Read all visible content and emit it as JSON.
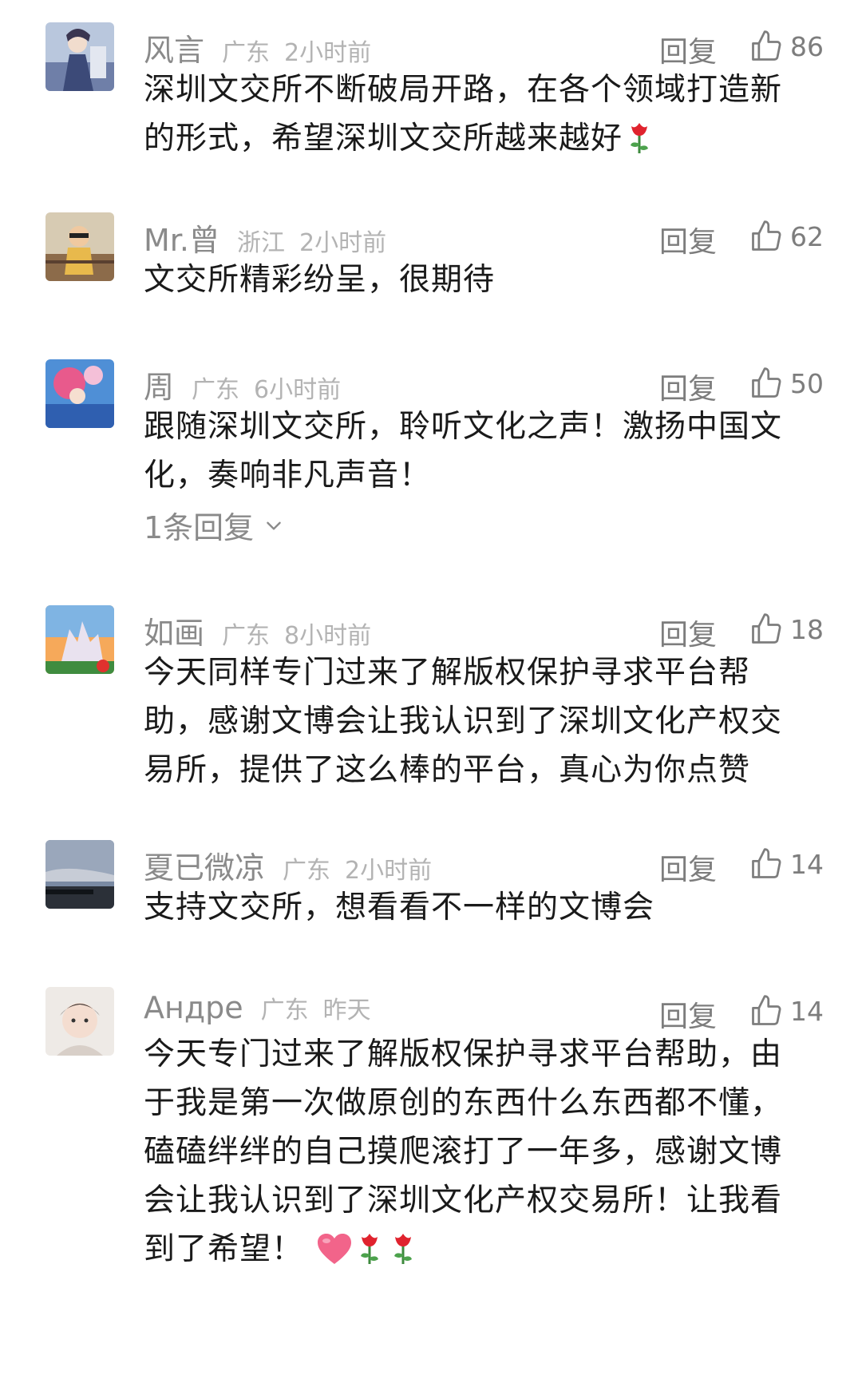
{
  "labels": {
    "reply": "回复"
  },
  "comments": [
    {
      "username": "风言",
      "location": "广东",
      "time": "2小时前",
      "likes": "86",
      "lines": [
        "深圳文交所不断破局开路，在各个领域打造新",
        "的形式，希望深圳文交所越来越好"
      ],
      "emoji": [
        "rose"
      ]
    },
    {
      "username": "Mr.曾",
      "location": "浙江",
      "time": "2小时前",
      "likes": "62",
      "lines": [
        "文交所精彩纷呈，很期待"
      ],
      "emoji": []
    },
    {
      "username": "周",
      "location": "广东",
      "time": "6小时前",
      "likes": "50",
      "lines": [
        "跟随深圳文交所，聆听文化之声！激扬中国文",
        "化，奏响非凡声音！"
      ],
      "emoji": [],
      "replies_link": "1条回复"
    },
    {
      "username": "如画",
      "location": "广东",
      "time": "8小时前",
      "likes": "18",
      "lines": [
        "今天同样专门过来了解版权保护寻求平台帮",
        "助，感谢文博会让我认识到了深圳文化产权交",
        "易所，提供了这么棒的平台，真心为你点赞"
      ],
      "emoji": []
    },
    {
      "username": "夏已微凉",
      "location": "广东",
      "time": "2小时前",
      "likes": "14",
      "lines": [
        "支持文交所，想看看不一样的文博会"
      ],
      "emoji": []
    },
    {
      "username": "Андре",
      "location": "广东",
      "time": "昨天",
      "likes": "14",
      "lines": [
        "今天专门过来了解版权保护寻求平台帮助，由",
        "于我是第一次做原创的东西什么东西都不懂，",
        "磕磕绊绊的自己摸爬滚打了一年多，感谢文博",
        "会让我认识到了深圳文化产权交易所！让我看",
        "到了希望！"
      ],
      "emoji": [
        "heart",
        "rose",
        "rose"
      ]
    }
  ]
}
